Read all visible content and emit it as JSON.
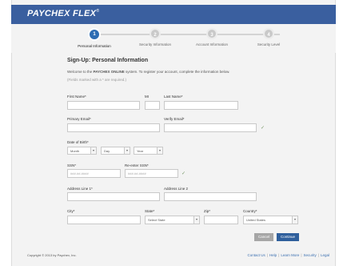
{
  "brand": {
    "name": "PAYCHEX FLEX",
    "tm": "®"
  },
  "steps": [
    {
      "num": "1",
      "label": "Personal Information",
      "active": true
    },
    {
      "num": "2",
      "label": "Security Information",
      "active": false
    },
    {
      "num": "3",
      "label": "Account Information",
      "active": false
    },
    {
      "num": "4",
      "label": "Security Level",
      "active": false
    }
  ],
  "form": {
    "heading": "Sign-Up: Personal Information",
    "intro_prefix": "Welcome to the ",
    "intro_brand": "PAYCHEX ONLINE",
    "intro_suffix": " system. To register your account, complete the information below.",
    "required_note": "(Fields marked with a * are required.)",
    "first_name": "First Name*",
    "mi": "MI",
    "last_name": "Last Name*",
    "primary_email": "Primary Email*",
    "verify_email": "Verify Email*",
    "dob": "Date of Birth*",
    "month": "Month",
    "day": "Day",
    "year": "Year",
    "ssn": "SSN*",
    "re_ssn": "Re-enter SSN*",
    "ssn_placeholder": "###-##-####",
    "address1": "Address Line 1*",
    "address2": "Address Line 2",
    "city": "City*",
    "state": "State*",
    "state_value": "Select State",
    "zip": "Zip*",
    "country": "Country*",
    "country_value": "United States",
    "cancel": "Cancel",
    "continue": "Continue",
    "check": "✓"
  },
  "footer": {
    "copyright": "Copyright © 2013 by Paychex, Inc.",
    "links": [
      "Contact Us",
      "Help",
      "Learn More",
      "Security",
      "Legal"
    ]
  }
}
